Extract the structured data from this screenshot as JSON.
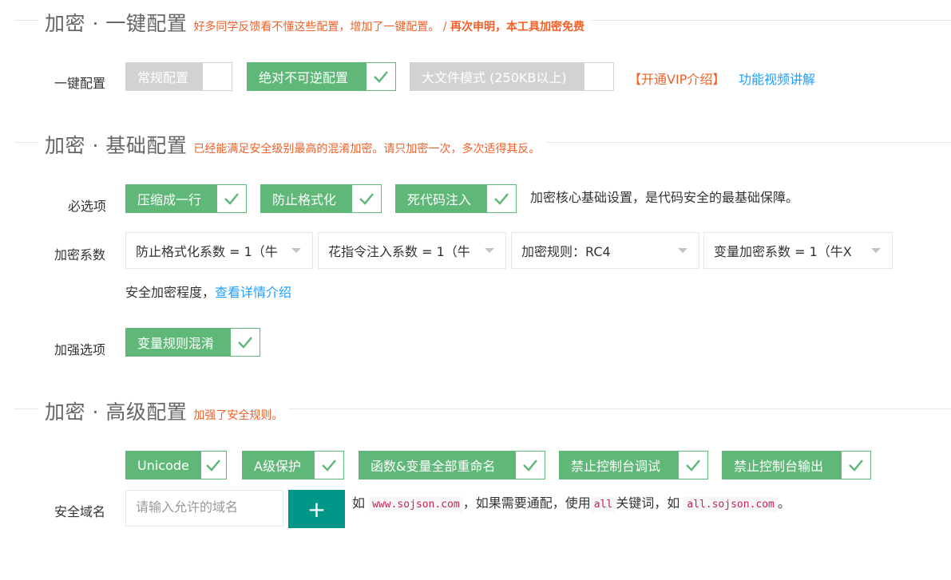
{
  "colors": {
    "accent_green": "#5fb878",
    "disabled_gray": "#d2d2d2",
    "teal_button": "#009688",
    "note_orange": "#f0612a",
    "link_blue": "#1e9fff"
  },
  "section1": {
    "title": "加密 · 一键配置",
    "note": "好多同学反馈看不懂这些配置，增加了一键配置。 / ",
    "note_bold": "再次申明，本工具加密免费",
    "row_label": "一键配置",
    "options": [
      {
        "label": "常规配置",
        "checked": false
      },
      {
        "label": "绝对不可逆配置",
        "checked": true
      },
      {
        "label": "大文件模式 (250KB以上)",
        "checked": false
      }
    ],
    "vip_link": "【开通VIP介绍】",
    "video_link": "功能视频讲解"
  },
  "section2": {
    "title": "加密 · 基础配置",
    "note": "已经能满足安全级别最高的混淆加密。请只加密一次，多次适得其反。",
    "required_label": "必选项",
    "required_options": [
      {
        "label": "压缩成一行",
        "checked": true
      },
      {
        "label": "防止格式化",
        "checked": true
      },
      {
        "label": "死代码注入",
        "checked": true
      }
    ],
    "required_desc": "加密核心基础设置，是代码安全的最基础保障。",
    "coef_label": "加密系数",
    "selects": [
      {
        "value": "防止格式化系数 = 1（牛"
      },
      {
        "value": "花指令注入系数 = 1（牛"
      },
      {
        "value": "加密规则：RC4"
      },
      {
        "value": "变量加密系数 = 1（牛X"
      }
    ],
    "security_text": "安全加密程度，",
    "security_link": "查看详情介绍",
    "enhance_label": "加强选项",
    "enhance_options": [
      {
        "label": "变量规则混淆",
        "checked": true
      }
    ]
  },
  "section3": {
    "title": "加密 · 高级配置",
    "note": "加强了安全规则。",
    "options": [
      {
        "label": "Unicode",
        "checked": true
      },
      {
        "label": "A级保护",
        "checked": true
      },
      {
        "label": "函数&变量全部重命名",
        "checked": true
      },
      {
        "label": "禁止控制台调试",
        "checked": true
      },
      {
        "label": "禁止控制台输出",
        "checked": true
      }
    ],
    "domain_label": "安全域名",
    "domain_placeholder": "请输入允许的域名",
    "add_button": "+",
    "hint_prefix": "如",
    "hint_example1": "www.sojson.com",
    "hint_mid": "，如果需要通配，使用",
    "hint_keyword": "all",
    "hint_mid2": "关键词，如",
    "hint_example2": "all.sojson.com",
    "hint_suffix": "。"
  }
}
